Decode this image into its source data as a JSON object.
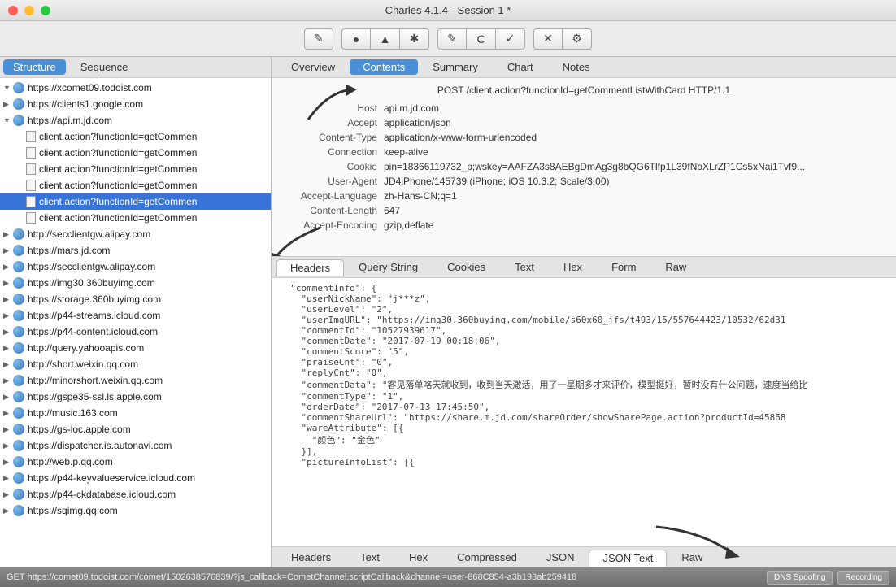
{
  "window": {
    "title": "Charles 4.1.4 - Session 1 *"
  },
  "sidebar_tabs": {
    "structure": "Structure",
    "sequence": "Sequence"
  },
  "hosts": [
    {
      "expanded": true,
      "label": "https://xcomet09.todoist.com",
      "children": []
    },
    {
      "expanded": false,
      "label": "https://clients1.google.com",
      "children": []
    },
    {
      "expanded": true,
      "label": "https://api.m.jd.com",
      "children": [
        "client.action?functionId=getCommen",
        "client.action?functionId=getCommen",
        "client.action?functionId=getCommen",
        "client.action?functionId=getCommen",
        "client.action?functionId=getCommen",
        "client.action?functionId=getCommen"
      ],
      "selected_child": 4
    },
    {
      "expanded": false,
      "label": "http://secclientgw.alipay.com"
    },
    {
      "expanded": false,
      "label": "https://mars.jd.com"
    },
    {
      "expanded": false,
      "label": "https://secclientgw.alipay.com"
    },
    {
      "expanded": false,
      "label": "https://img30.360buyimg.com"
    },
    {
      "expanded": false,
      "label": "https://storage.360buyimg.com"
    },
    {
      "expanded": false,
      "label": "https://p44-streams.icloud.com"
    },
    {
      "expanded": false,
      "label": "https://p44-content.icloud.com"
    },
    {
      "expanded": false,
      "label": "http://query.yahooapis.com"
    },
    {
      "expanded": false,
      "label": "http://short.weixin.qq.com"
    },
    {
      "expanded": false,
      "label": "http://minorshort.weixin.qq.com"
    },
    {
      "expanded": false,
      "label": "https://gspe35-ssl.ls.apple.com"
    },
    {
      "expanded": false,
      "label": "http://music.163.com"
    },
    {
      "expanded": false,
      "label": "https://gs-loc.apple.com"
    },
    {
      "expanded": false,
      "label": "https://dispatcher.is.autonavi.com"
    },
    {
      "expanded": false,
      "label": "http://web.p.qq.com"
    },
    {
      "expanded": false,
      "label": "https://p44-keyvalueservice.icloud.com"
    },
    {
      "expanded": false,
      "label": "https://p44-ckdatabase.icloud.com"
    },
    {
      "expanded": false,
      "label": "https://sqimg.qq.com"
    }
  ],
  "content_tabs": {
    "overview": "Overview",
    "contents": "Contents",
    "summary": "Summary",
    "chart": "Chart",
    "notes": "Notes"
  },
  "request": {
    "line": "POST /client.action?functionId=getCommentListWithCard HTTP/1.1",
    "headers": [
      {
        "name": "Host",
        "value": "api.m.jd.com"
      },
      {
        "name": "Accept",
        "value": "application/json"
      },
      {
        "name": "Content-Type",
        "value": "application/x-www-form-urlencoded"
      },
      {
        "name": "Connection",
        "value": "keep-alive"
      },
      {
        "name": "Cookie",
        "value": "pin=18366119732_p;wskey=AAFZA3s8AEBgDmAg3g8bQG6Tlfp1L39fNoXLrZP1Cs5xNai1Tvf9..."
      },
      {
        "name": "User-Agent",
        "value": "JD4iPhone/145739 (iPhone; iOS 10.3.2; Scale/3.00)"
      },
      {
        "name": "Accept-Language",
        "value": "zh-Hans-CN;q=1"
      },
      {
        "name": "Content-Length",
        "value": "647"
      },
      {
        "name": "Accept-Encoding",
        "value": "gzip,deflate"
      }
    ]
  },
  "request_sub_tabs": {
    "headers": "Headers",
    "query": "Query String",
    "cookies": "Cookies",
    "text": "Text",
    "hex": "Hex",
    "form": "Form",
    "raw": "Raw"
  },
  "response_body": "  \"commentInfo\": {\n    \"userNickName\": \"j***z\",\n    \"userLevel\": \"2\",\n    \"userImgURL\": \"https://img30.360buying.com/mobile/s60x60_jfs/t493/15/557644423/10532/62d31\n    \"commentId\": \"10527939617\",\n    \"commentDate\": \"2017-07-19 00:18:06\",\n    \"commentScore\": \"5\",\n    \"praiseCnt\": \"0\",\n    \"replyCnt\": \"0\",\n    \"commentData\": \"客见落单咯天就收到，收到当天激活，用了一星期多才来评价，模型挺好，暂时没有什公问题，速度当给比\n    \"commentType\": \"1\",\n    \"orderDate\": \"2017-07-13 17:45:50\",\n    \"commentShareUrl\": \"https://share.m.jd.com/shareOrder/showSharePage.action?productId=45868\n    \"wareAttribute\": [{\n      \"颜色\": \"金色\"\n    }],\n    \"pictureInfoList\": [{",
  "response_sub_tabs": {
    "headers": "Headers",
    "text": "Text",
    "hex": "Hex",
    "compressed": "Compressed",
    "json": "JSON",
    "json_text": "JSON Text",
    "raw": "Raw"
  },
  "statusbar": {
    "text": "GET https://comet09.todoist.com/comet/1502638576839/?js_callback=CometChannel.scriptCallback&channel=user-868C854-a3b193ab259418",
    "dns": "DNS Spoofing",
    "recording": "Recording"
  }
}
